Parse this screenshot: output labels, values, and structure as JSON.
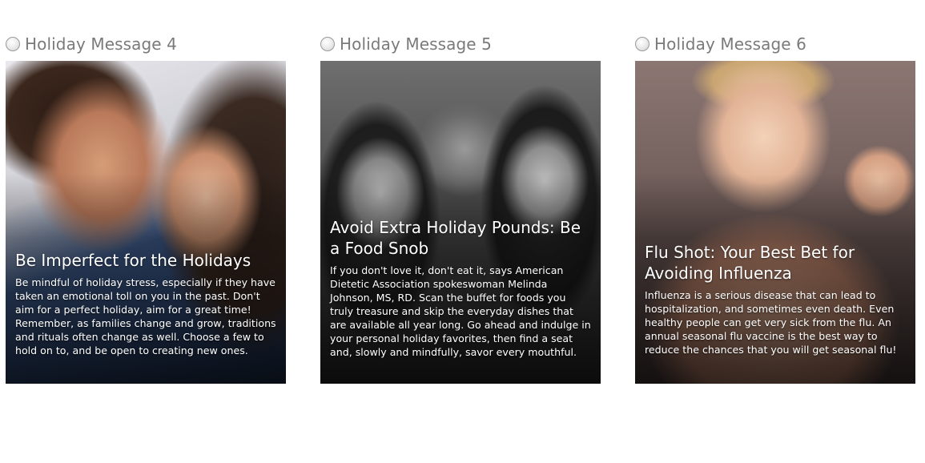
{
  "options": [
    {
      "label": "Holiday Message 4",
      "selected": false,
      "title": "Be Imperfect for the Holidays",
      "body": "Be mindful of holiday stress, especially if they have taken an emotional toll on you in the past. Don't aim for a perfect holiday, aim for a great time! Remember, as families change and grow, traditions and rituals often change as well. Choose a few to hold on to, and be open to creating new ones."
    },
    {
      "label": "Holiday Message 5",
      "selected": false,
      "title": "Avoid Extra Holiday Pounds: Be a Food Snob",
      "body": "If you don't love it, don't eat it, says American Dietetic Association spokeswoman Melinda Johnson, MS, RD. Scan the buffet for foods you truly treasure and skip the everyday dishes that are available all year long. Go ahead and indulge in your personal holiday favorites, then find a seat and, slowly and mindfully, savor every mouthful."
    },
    {
      "label": "Holiday Message 6",
      "selected": false,
      "title": "Flu Shot: Your Best Bet for Avoiding Influenza",
      "body": "Influenza is a serious disease that can lead to hospitalization, and sometimes even death. Even healthy people can get very sick from the flu. An annual seasonal flu vaccine is the best way to reduce the chances that you will get seasonal flu!"
    }
  ]
}
